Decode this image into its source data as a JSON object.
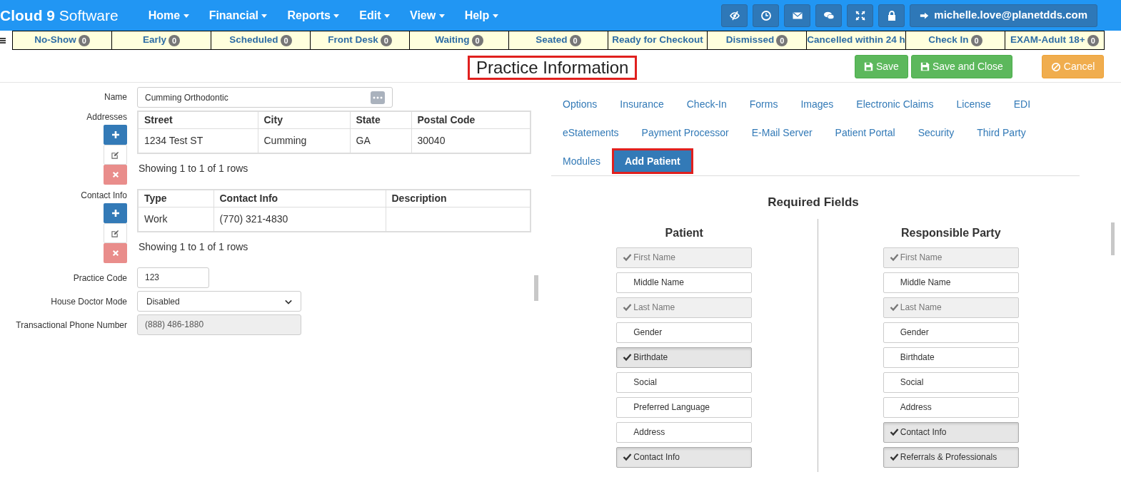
{
  "brand": {
    "name": "Cloud 9",
    "suffix": "Software"
  },
  "menu": [
    {
      "label": "Home"
    },
    {
      "label": "Financial"
    },
    {
      "label": "Reports"
    },
    {
      "label": "Edit"
    },
    {
      "label": "View"
    },
    {
      "label": "Help"
    }
  ],
  "toolbar": {
    "user": "michelle.love@planetdds.com"
  },
  "status_bar": [
    {
      "label": "No-Show",
      "count": "0"
    },
    {
      "label": "Early",
      "count": "0"
    },
    {
      "label": "Scheduled",
      "count": "0"
    },
    {
      "label": "Front Desk",
      "count": "0"
    },
    {
      "label": "Waiting",
      "count": "0"
    },
    {
      "label": "Seated",
      "count": "0"
    },
    {
      "label": "Ready for Checkout"
    },
    {
      "label": "Dismissed",
      "count": "0"
    },
    {
      "label": "Cancelled within 24 h"
    },
    {
      "label": "Check In",
      "count": "0"
    },
    {
      "label": "EXAM-Adult 18+",
      "count": "0"
    }
  ],
  "page_title": "Practice Information",
  "actions": [
    {
      "kind": "save",
      "label": "Save"
    },
    {
      "kind": "save",
      "label": "Save and Close"
    },
    {
      "kind": "cancel",
      "label": "Cancel"
    }
  ],
  "form": {
    "name": {
      "label": "Name",
      "value": "Cumming Orthodontic"
    },
    "addresses": {
      "label": "Addresses",
      "columns": [
        "Street",
        "City",
        "State",
        "Postal Code"
      ],
      "rows": [
        [
          "1234 Test ST",
          "Cumming",
          "GA",
          "30040"
        ]
      ],
      "footer": "Showing 1 to 1 of 1 rows"
    },
    "contact_info": {
      "label": "Contact Info",
      "columns": [
        "Type",
        "Contact Info",
        "Description"
      ],
      "rows": [
        [
          "Work",
          "(770) 321-4830",
          ""
        ]
      ],
      "footer": "Showing 1 to 1 of 1 rows"
    },
    "practice_code": {
      "label": "Practice Code",
      "value": "123"
    },
    "house_doctor_mode": {
      "label": "House Doctor Mode",
      "value": "Disabled"
    },
    "transactional_phone": {
      "label": "Transactional Phone Number",
      "value": "(888) 486-1880"
    }
  },
  "tabs": [
    {
      "label": "Options",
      "selected": false
    },
    {
      "label": "Insurance",
      "selected": false
    },
    {
      "label": "Check-In",
      "selected": false
    },
    {
      "label": "Forms",
      "selected": false
    },
    {
      "label": "Images",
      "selected": false
    },
    {
      "label": "Electronic Claims",
      "selected": false
    },
    {
      "label": "License",
      "selected": false
    },
    {
      "label": "EDI",
      "selected": false
    },
    {
      "label": "eStatements",
      "selected": false
    },
    {
      "label": "Payment Processor",
      "selected": false
    },
    {
      "label": "E-Mail Server",
      "selected": false
    },
    {
      "label": "Patient Portal",
      "selected": false
    },
    {
      "label": "Security",
      "selected": false
    },
    {
      "label": "Third Party",
      "selected": false
    },
    {
      "label": "Modules",
      "selected": false
    },
    {
      "label": "Add Patient",
      "selected": true
    }
  ],
  "required_fields": {
    "title": "Required Fields",
    "groups": [
      {
        "title": "Patient",
        "fields": [
          {
            "label": "First Name",
            "checked": true,
            "disabled": true
          },
          {
            "label": "Middle Name",
            "checked": false,
            "disabled": false
          },
          {
            "label": "Last Name",
            "checked": true,
            "disabled": true
          },
          {
            "label": "Gender",
            "checked": false,
            "disabled": false
          },
          {
            "label": "Birthdate",
            "checked": true,
            "disabled": false
          },
          {
            "label": "Social",
            "checked": false,
            "disabled": false
          },
          {
            "label": "Preferred Language",
            "checked": false,
            "disabled": false
          },
          {
            "label": "Address",
            "checked": false,
            "disabled": false
          },
          {
            "label": "Contact Info",
            "checked": true,
            "disabled": false
          }
        ]
      },
      {
        "title": "Responsible Party",
        "fields": [
          {
            "label": "First Name",
            "checked": true,
            "disabled": true
          },
          {
            "label": "Middle Name",
            "checked": false,
            "disabled": false
          },
          {
            "label": "Last Name",
            "checked": true,
            "disabled": true
          },
          {
            "label": "Gender",
            "checked": false,
            "disabled": false
          },
          {
            "label": "Birthdate",
            "checked": false,
            "disabled": false
          },
          {
            "label": "Social",
            "checked": false,
            "disabled": false
          },
          {
            "label": "Address",
            "checked": false,
            "disabled": false
          },
          {
            "label": "Contact Info",
            "checked": true,
            "disabled": false
          },
          {
            "label": "Referrals & Professionals",
            "checked": true,
            "disabled": false
          }
        ]
      }
    ]
  }
}
